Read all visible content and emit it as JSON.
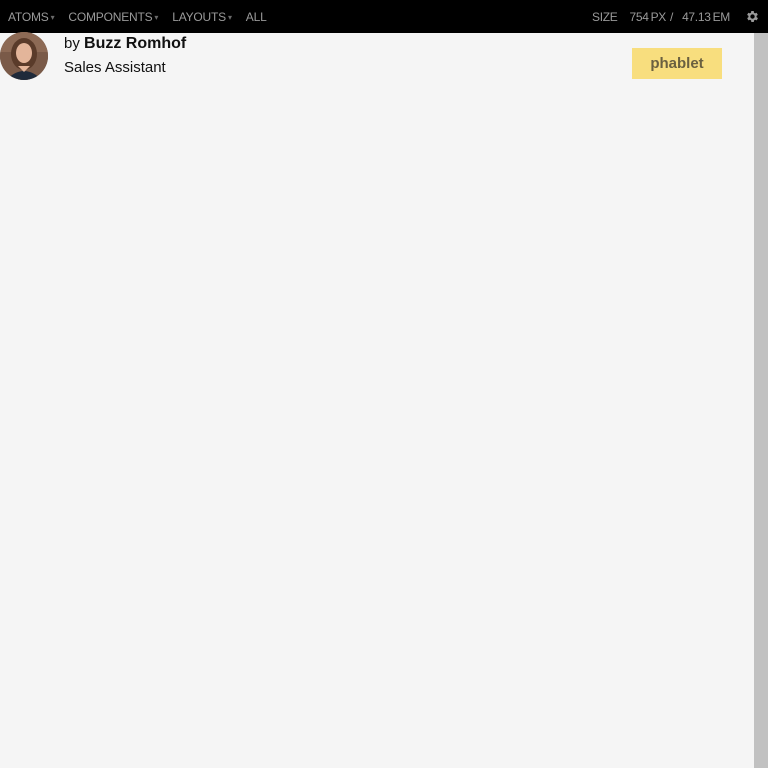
{
  "nav": {
    "items": [
      {
        "label": "ATOMS",
        "has_dropdown": true
      },
      {
        "label": "COMPONENTS",
        "has_dropdown": true
      },
      {
        "label": "LAYOUTS",
        "has_dropdown": true
      },
      {
        "label": "ALL",
        "has_dropdown": false
      }
    ],
    "dropdown_glyph": "▾"
  },
  "size": {
    "label": "SIZE",
    "px_value": "754",
    "px_unit": "PX",
    "separator": "/",
    "em_value": "47.13",
    "em_unit": "EM"
  },
  "settings": {
    "icon": "gear-icon"
  },
  "author": {
    "by_prefix": "by",
    "name": "Buzz Romhof",
    "job_title": "Sales Assistant"
  },
  "viewport_badge": {
    "label": "phablet",
    "color": "#f8de7e"
  },
  "colors": {
    "topbar": "#000000",
    "background": "#f5f5f5",
    "scrollbar": "#c1c1c1"
  }
}
